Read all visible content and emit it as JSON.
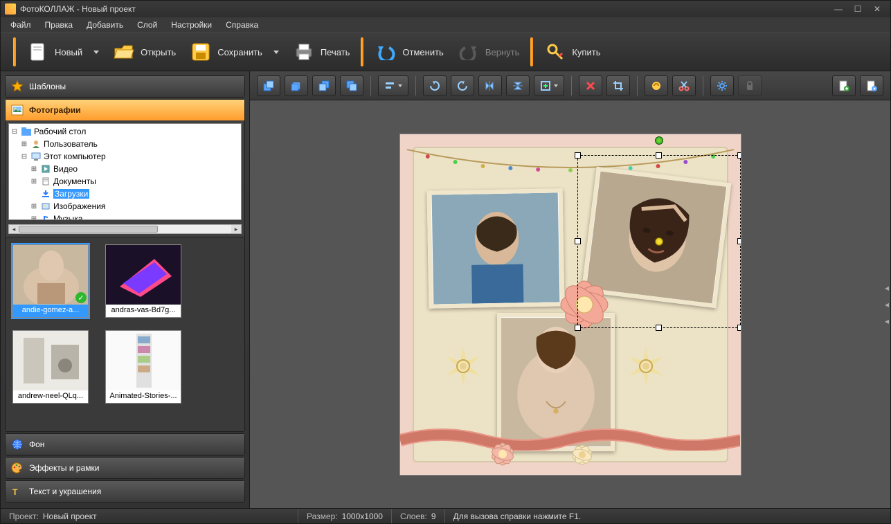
{
  "title": "ФотоКОЛЛАЖ - Новый проект",
  "menubar": [
    "Файл",
    "Правка",
    "Добавить",
    "Слой",
    "Настройки",
    "Справка"
  ],
  "maintoolbar": {
    "new": "Новый",
    "open": "Открыть",
    "save": "Сохранить",
    "print": "Печать",
    "undo": "Отменить",
    "redo": "Вернуть",
    "buy": "Купить"
  },
  "accordion": {
    "templates": "Шаблоны",
    "photos": "Фотографии",
    "background": "Фон",
    "effects": "Эффекты и рамки",
    "text": "Текст и украшения"
  },
  "tree": {
    "root": "Рабочий стол",
    "user": "Пользователь",
    "computer": "Этот компьютер",
    "video": "Видео",
    "documents": "Документы",
    "downloads": "Загрузки",
    "images": "Изображения",
    "music": "Музыка"
  },
  "thumbs": [
    {
      "name": "andie-gomez-a...",
      "selected": true,
      "used": true
    },
    {
      "name": "andras-vas-Bd7g...",
      "selected": false,
      "used": false
    },
    {
      "name": "andrew-neel-QLq...",
      "selected": false,
      "used": false
    },
    {
      "name": "Animated-Stories-...",
      "selected": false,
      "used": false
    }
  ],
  "status": {
    "project_key": "Проект:",
    "project_val": "Новый проект",
    "size_key": "Размер:",
    "size_val": "1000x1000",
    "layers_key": "Слоев:",
    "layers_val": "9",
    "help": "Для вызова справки нажмите F1."
  }
}
